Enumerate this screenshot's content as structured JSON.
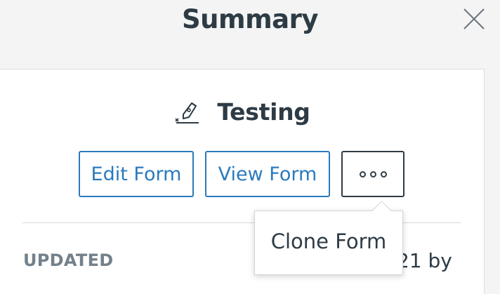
{
  "header": {
    "title": "Summary",
    "close_icon": "close-icon"
  },
  "form": {
    "title": "Testing",
    "icon": "pen-sign-icon"
  },
  "actions": {
    "edit_label": "Edit Form",
    "view_label": "View Form",
    "more_icon": "ellipsis-icon"
  },
  "menu": {
    "items": [
      {
        "label": "Clone Form"
      }
    ]
  },
  "details": {
    "updated_label": "UPDATED",
    "updated_value_partial": "21 by",
    "updated_value_line2": "...."
  },
  "colors": {
    "accent": "#2b7abc",
    "text": "#2d3b45",
    "muted": "#73818a"
  }
}
